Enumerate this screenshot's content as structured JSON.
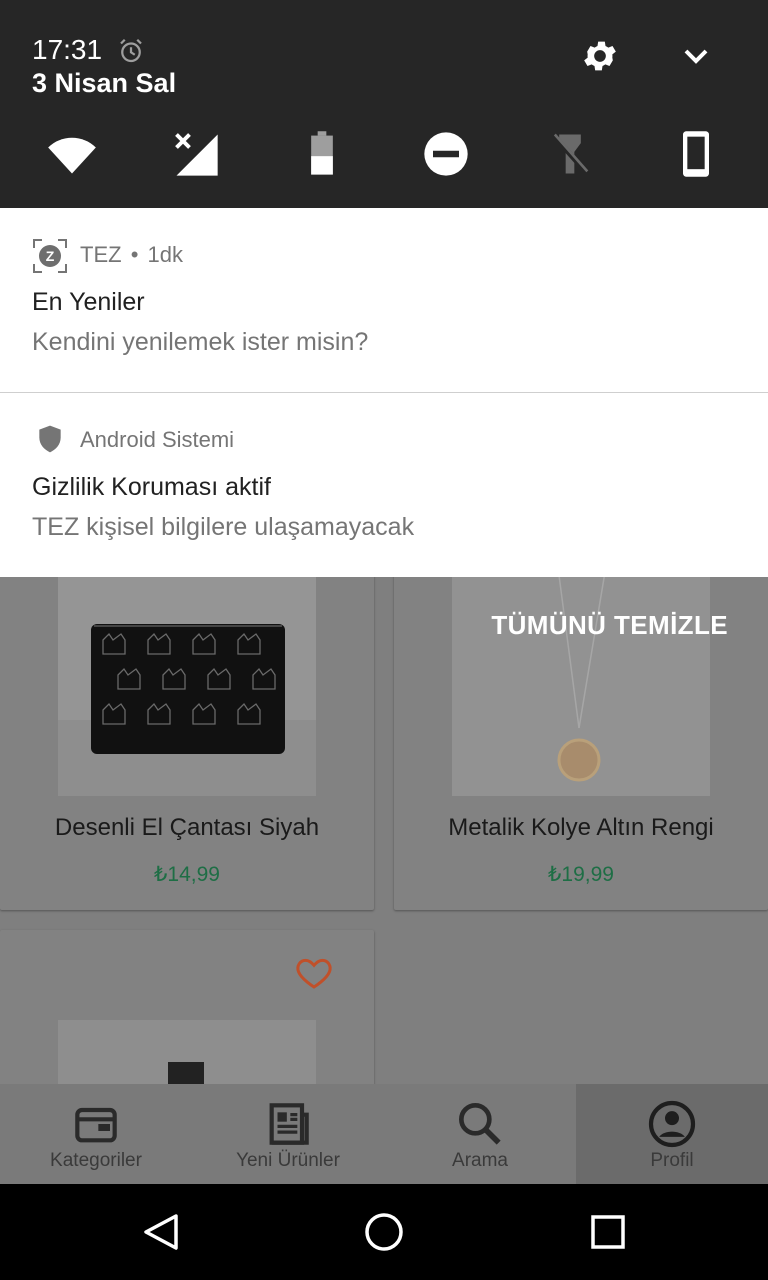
{
  "status": {
    "time": "17:31",
    "date": "3 Nisan Sal"
  },
  "quick_settings": [
    "wifi-icon",
    "mobile-data-off-icon",
    "battery-icon",
    "do-not-disturb-icon",
    "flashlight-icon",
    "rotation-icon"
  ],
  "notifications": [
    {
      "app": "TEZ",
      "sep": "•",
      "age": "1dk",
      "title": "En Yeniler",
      "body": "Kendini yenilemek ister misin?"
    },
    {
      "app": "Android Sistemi",
      "title": "Gizlilik Koruması aktif",
      "body": "TEZ kişisel bilgilere ulaşamayacak"
    }
  ],
  "clear_all": "TÜMÜNÜ TEMİZLE",
  "products": [
    {
      "name": "Desenli El Çantası Siyah",
      "price": "₺14,99"
    },
    {
      "name": "Metalik Kolye Altın Rengi",
      "price": "₺19,99"
    }
  ],
  "bottom_nav": [
    {
      "label": "Kategoriler",
      "icon": "wallet-icon"
    },
    {
      "label": "Yeni Ürünler",
      "icon": "news-icon"
    },
    {
      "label": "Arama",
      "icon": "search-icon"
    },
    {
      "label": "Profil",
      "icon": "account-icon",
      "active": true
    }
  ],
  "colors": {
    "shade": "#262626",
    "price": "#1e6e45",
    "heart": "#c0502a"
  }
}
